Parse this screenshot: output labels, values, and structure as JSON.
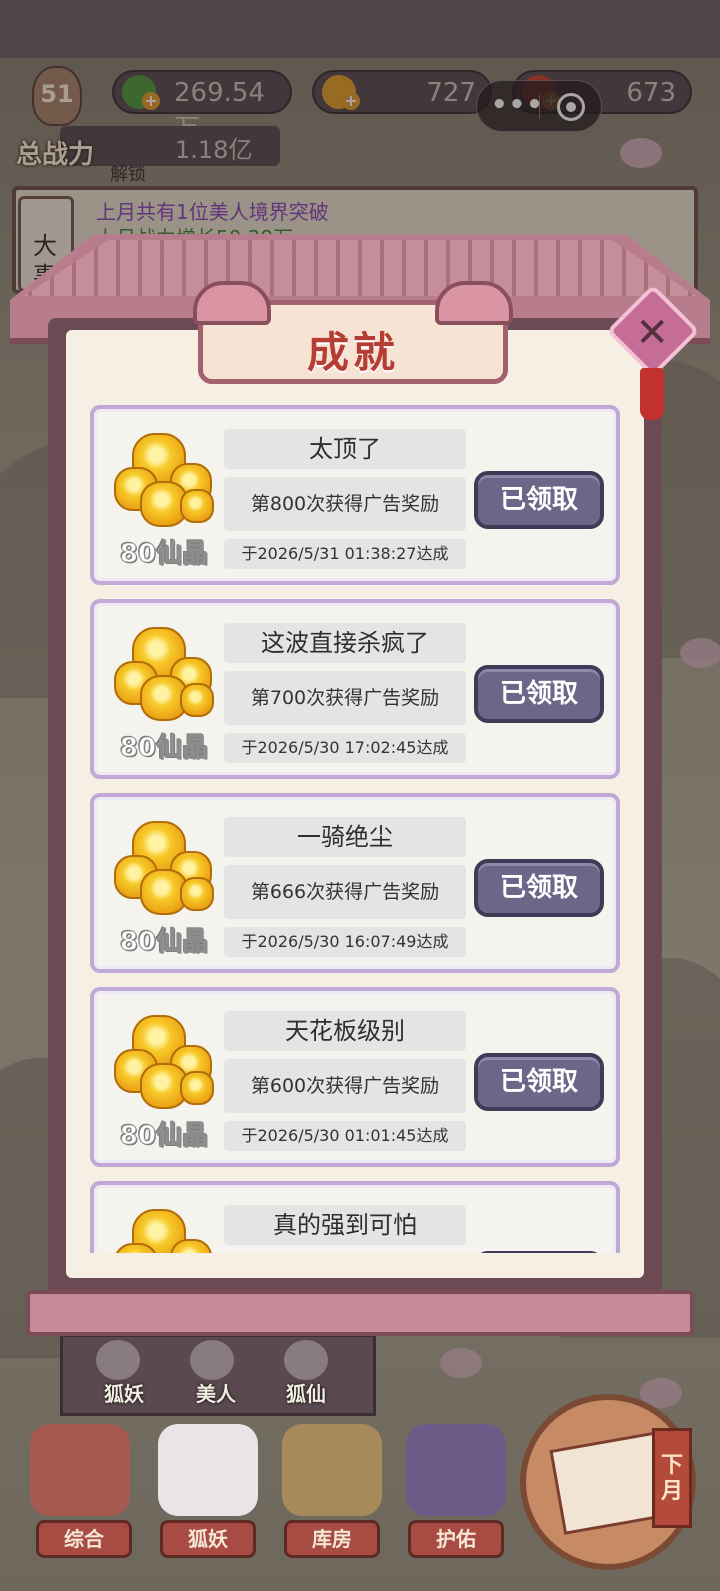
{
  "hud": {
    "level": "51",
    "power_label": "总战力",
    "power_value": "1.18亿",
    "resources": [
      {
        "icon": "jade-leaf-icon",
        "value": "269.54万"
      },
      {
        "icon": "gold-ingot-icon",
        "value": "727"
      },
      {
        "icon": "red-gourd-icon",
        "value": "673"
      }
    ],
    "unlock_text": "解锁"
  },
  "news": {
    "tag": "大事",
    "line1": "上月共有1位美人境界突破",
    "line2": "上月战力增长50.29万"
  },
  "modal": {
    "title": "成就",
    "close_icon": "close-icon",
    "achievements": [
      {
        "title": "太顶了",
        "desc": "第800次获得广告奖励",
        "date": "于2026/5/31   01:38:27达成",
        "reward": "80仙晶",
        "button": "已领取"
      },
      {
        "title": "这波直接杀疯了",
        "desc": "第700次获得广告奖励",
        "date": "于2026/5/30   17:02:45达成",
        "reward": "80仙晶",
        "button": "已领取"
      },
      {
        "title": "一骑绝尘",
        "desc": "第666次获得广告奖励",
        "date": "于2026/5/30   16:07:49达成",
        "reward": "80仙晶",
        "button": "已领取"
      },
      {
        "title": "天花板级别",
        "desc": "第600次获得广告奖励",
        "date": "于2026/5/30   01:01:45达成",
        "reward": "80仙晶",
        "button": "已领取"
      },
      {
        "title": "真的强到可怕",
        "desc": "",
        "date": "",
        "reward": "",
        "button": ""
      }
    ]
  },
  "subtabs": [
    "狐妖",
    "美人",
    "狐仙"
  ],
  "nav": [
    "综合",
    "狐妖",
    "库房",
    "护佑"
  ],
  "calendar_label": "下月",
  "colors": {
    "accent": "#a3616f",
    "button": "#6e6689",
    "title": "#b53d33",
    "card_border": "#c1a8d6"
  }
}
